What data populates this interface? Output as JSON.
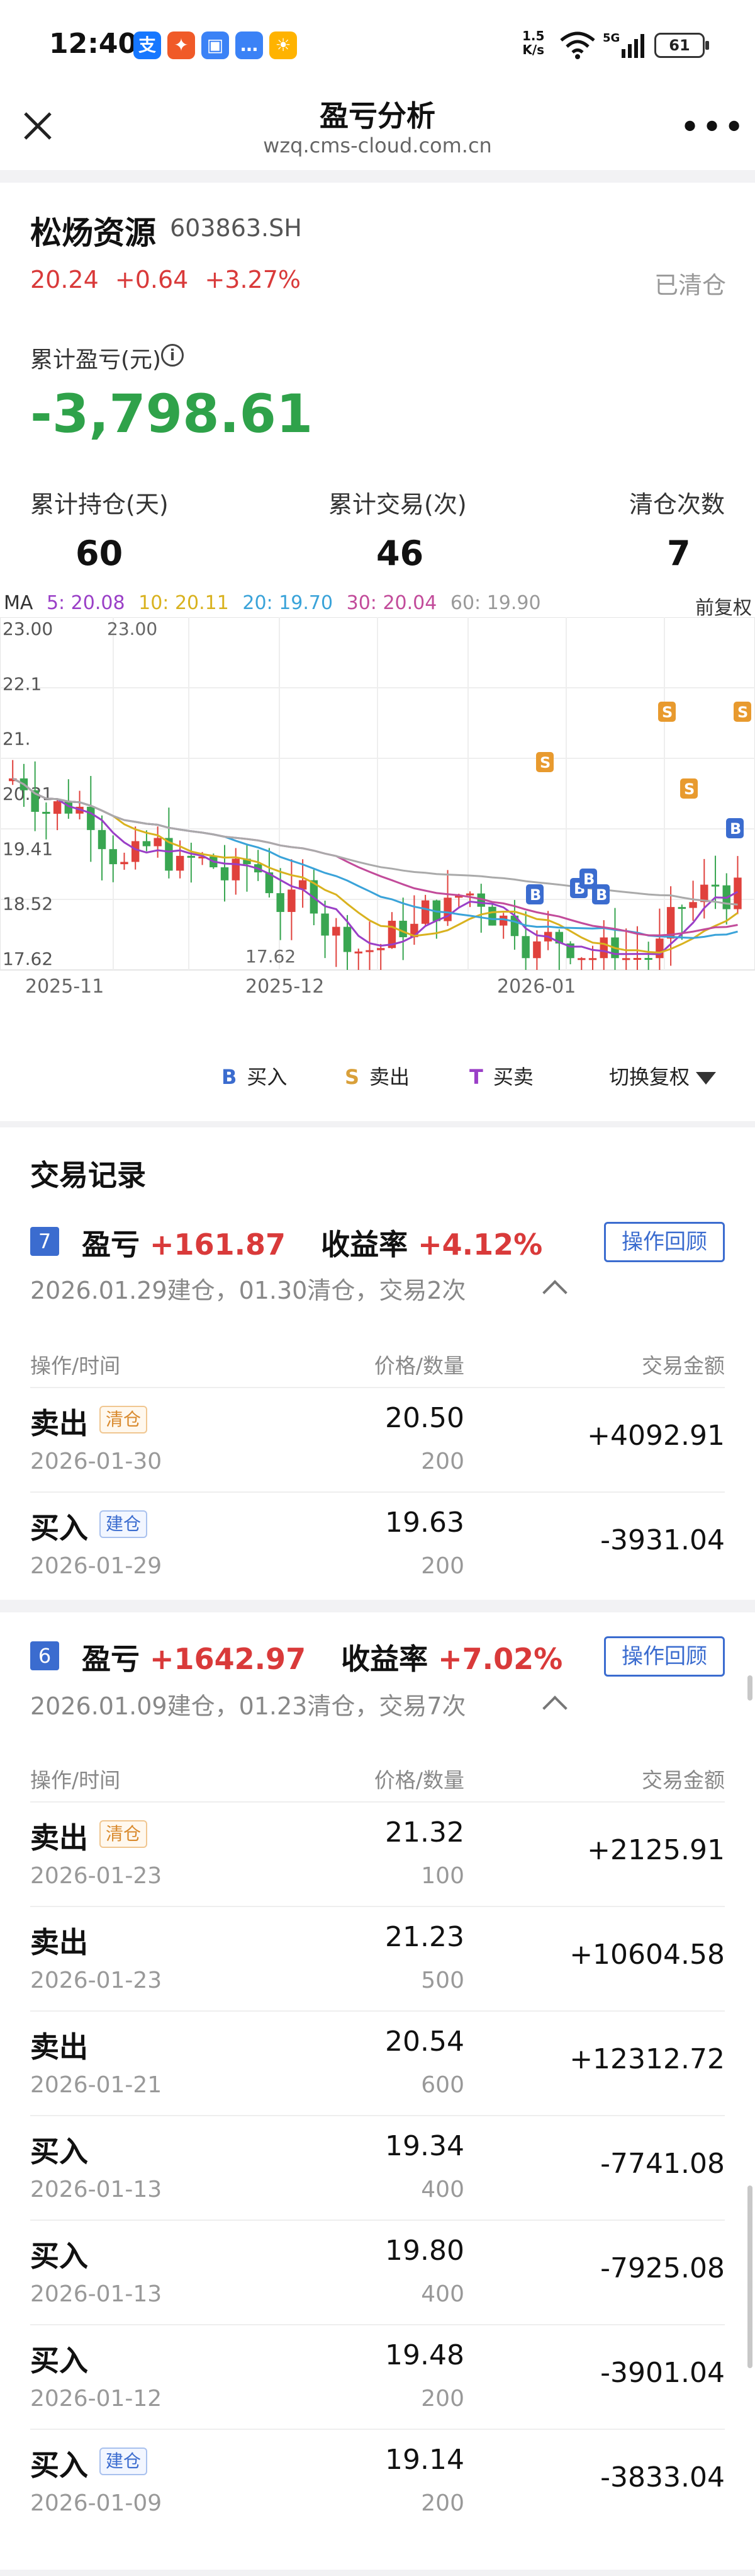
{
  "status_bar": {
    "time": "12:40",
    "net_speed_top": "1.5",
    "net_speed_bottom": "K/s",
    "battery": "61"
  },
  "header": {
    "title": "盈亏分析",
    "url": "wzq.cms-cloud.com.cn"
  },
  "stock": {
    "name": "松炀资源",
    "code": "603863.SH",
    "price": "20.24",
    "change": "+0.64",
    "change_pct": "+3.27%",
    "position_status": "已清仓",
    "pnl_label": "累计盈亏(元)",
    "pnl_value": "-3,798.61",
    "stats": [
      {
        "label": "累计持仓(天)",
        "value": "60"
      },
      {
        "label": "累计交易(次)",
        "value": "46"
      },
      {
        "label": "清仓次数",
        "value": "7"
      }
    ]
  },
  "ma_line": {
    "prefix": "MA",
    "ma5": "5: 20.08",
    "ma10": "10: 20.11",
    "ma20": "20: 19.70",
    "ma30": "30: 20.04",
    "ma60": "60: 19.90",
    "adjust": "前复权",
    "colors": {
      "ma5": "#9a3fc7",
      "ma10": "#d9b21f",
      "ma20": "#3aa3d9",
      "ma30": "#c24b9a",
      "ma60": "#999999"
    }
  },
  "chart_data": {
    "type": "candlestick",
    "y_ticks": [
      "23.00",
      "22.1",
      "21.",
      "20.31",
      "19.41",
      "18.52",
      "17.62"
    ],
    "x_ticks": [
      "2025-11",
      "2025-12",
      "2026-01"
    ],
    "high_label": "23.00",
    "low_label": "17.62",
    "ylim": [
      17.62,
      23.0
    ],
    "up_color": "#e0413c",
    "down_color": "#39a651",
    "trade_markers": [
      "B",
      "S"
    ]
  },
  "legend": {
    "buy": "买入",
    "sell": "卖出",
    "trade": "买卖",
    "switch": "切换复权",
    "buy_letter": "B",
    "sell_letter": "S",
    "trade_letter": "T"
  },
  "records": {
    "title": "交易记录",
    "columns": {
      "op": "操作/时间",
      "price": "价格/数量",
      "amount": "交易金额"
    },
    "review_label": "操作回顾",
    "pnl_word": "盈亏",
    "rate_word": "收益率",
    "groups": [
      {
        "num": "7",
        "pnl": "+161.87",
        "rate": "+4.12%",
        "summary": "2026.01.29建仓，01.30清仓，交易2次",
        "rows": [
          {
            "act": "卖出",
            "tag": "清仓",
            "date": "2026-01-30",
            "price": "20.50",
            "qty": "200",
            "amount": "+4092.91"
          },
          {
            "act": "买入",
            "tag": "建仓",
            "date": "2026-01-29",
            "price": "19.63",
            "qty": "200",
            "amount": "-3931.04"
          }
        ]
      },
      {
        "num": "6",
        "pnl": "+1642.97",
        "rate": "+7.02%",
        "summary": "2026.01.09建仓，01.23清仓，交易7次",
        "rows": [
          {
            "act": "卖出",
            "tag": "清仓",
            "date": "2026-01-23",
            "price": "21.32",
            "qty": "100",
            "amount": "+2125.91"
          },
          {
            "act": "卖出",
            "tag": "",
            "date": "2026-01-23",
            "price": "21.23",
            "qty": "500",
            "amount": "+10604.58"
          },
          {
            "act": "卖出",
            "tag": "",
            "date": "2026-01-21",
            "price": "20.54",
            "qty": "600",
            "amount": "+12312.72"
          },
          {
            "act": "买入",
            "tag": "",
            "date": "2026-01-13",
            "price": "19.34",
            "qty": "400",
            "amount": "-7741.08"
          },
          {
            "act": "买入",
            "tag": "",
            "date": "2026-01-13",
            "price": "19.80",
            "qty": "400",
            "amount": "-7925.08"
          },
          {
            "act": "买入",
            "tag": "",
            "date": "2026-01-12",
            "price": "19.48",
            "qty": "200",
            "amount": "-3901.04"
          },
          {
            "act": "买入",
            "tag": "建仓",
            "date": "2026-01-09",
            "price": "19.14",
            "qty": "200",
            "amount": "-3833.04"
          }
        ]
      }
    ]
  }
}
